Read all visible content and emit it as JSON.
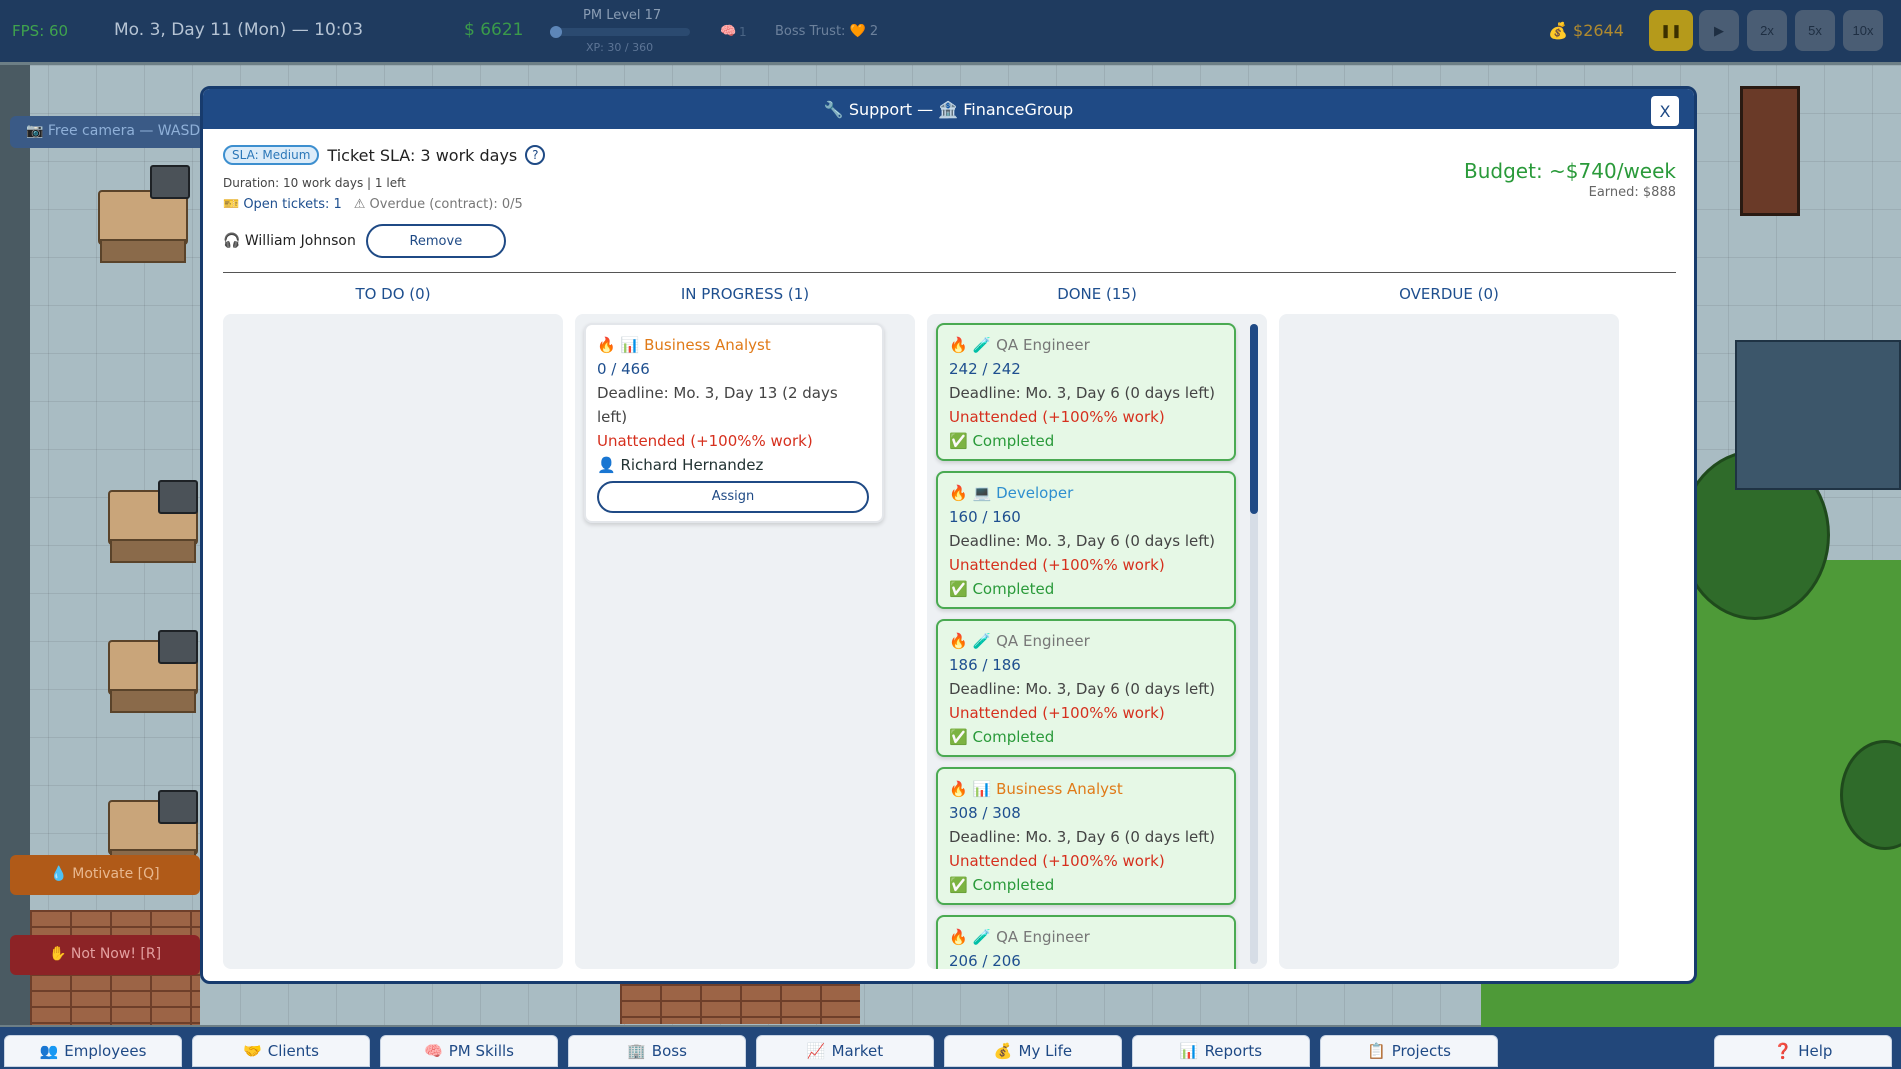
{
  "hud": {
    "fps": "FPS: 60",
    "date": "Mo. 3, Day 11 (Mon) — 10:03",
    "money": "$ 6621",
    "pm_level": "PM Level 17",
    "xp": "XP: 30 / 360",
    "xp_fraction": 0.083,
    "brain_count": "1",
    "boss_trust": "Boss Trust: 🧡 2",
    "cash": "💰 $2644",
    "speed_buttons": [
      "❚❚",
      "▶",
      "2x",
      "5x",
      "10x"
    ]
  },
  "overlay": {
    "free_camera": "📷 Free camera — WASD",
    "motivate": "💧 Motivate [Q]",
    "not_now": "✋ Not Now! [R]"
  },
  "modal": {
    "title": "🔧 Support — 🏦 FinanceGroup",
    "close": "X",
    "sla_badge": "SLA: Medium",
    "sla_title": "Ticket SLA: 3 work days",
    "help": "?",
    "duration": "Duration: 10 work days | 1 left",
    "open_tickets": "🎫 Open tickets: 1",
    "overdue_contract": "⚠ Overdue (contract): 0/5",
    "agent": "🎧 William Johnson",
    "remove": "Remove",
    "budget": "Budget: ~$740/week",
    "earned": "Earned: $888",
    "columns": {
      "todo": "TO DO (0)",
      "in_progress": "IN PROGRESS (1)",
      "done": "DONE (15)",
      "overdue": "OVERDUE (0)"
    },
    "in_progress_card": {
      "icons": "🔥 📊",
      "role": "Business Analyst",
      "progress": "0 / 466",
      "deadline": "Deadline: Mo. 3, Day 13 (2 days left)",
      "unattended": "Unattended (+100%% work)",
      "assignee": "👤 Richard Hernandez",
      "assign": "Assign"
    },
    "done_cards": [
      {
        "icons": "🔥 🧪",
        "role": "QA Engineer",
        "progress": "242 / 242",
        "deadline": "Deadline: Mo. 3, Day 6 (0 days left)",
        "unattended": "Unattended (+100%% work)",
        "status": "✅ Completed"
      },
      {
        "icons": "🔥 💻",
        "role": "Developer",
        "progress": "160 / 160",
        "deadline": "Deadline: Mo. 3, Day 6 (0 days left)",
        "unattended": "Unattended (+100%% work)",
        "status": "✅ Completed"
      },
      {
        "icons": "🔥 🧪",
        "role": "QA Engineer",
        "progress": "186 / 186",
        "deadline": "Deadline: Mo. 3, Day 6 (0 days left)",
        "unattended": "Unattended (+100%% work)",
        "status": "✅ Completed"
      },
      {
        "icons": "🔥 📊",
        "role": "Business Analyst",
        "progress": "308 / 308",
        "deadline": "Deadline: Mo. 3, Day 6 (0 days left)",
        "unattended": "Unattended (+100%% work)",
        "status": "✅ Completed"
      },
      {
        "icons": "🔥 🧪",
        "role": "QA Engineer",
        "progress": "206 / 206",
        "deadline": "",
        "unattended": "",
        "status": ""
      }
    ]
  },
  "bottom_nav": [
    {
      "icon": "👥",
      "label": "Employees"
    },
    {
      "icon": "🤝",
      "label": "Clients"
    },
    {
      "icon": "🧠",
      "label": "PM Skills"
    },
    {
      "icon": "🏢",
      "label": "Boss"
    },
    {
      "icon": "📈",
      "label": "Market"
    },
    {
      "icon": "💰",
      "label": "My Life"
    },
    {
      "icon": "📊",
      "label": "Reports"
    },
    {
      "icon": "📋",
      "label": "Projects"
    },
    {
      "icon": "❓",
      "label": "Help"
    }
  ],
  "colors": {
    "header": "#1f4a85",
    "done_border": "#4aaa52",
    "done_bg": "#e6f8e6",
    "unattended": "#d6301e",
    "budget": "#2a9a3a"
  }
}
